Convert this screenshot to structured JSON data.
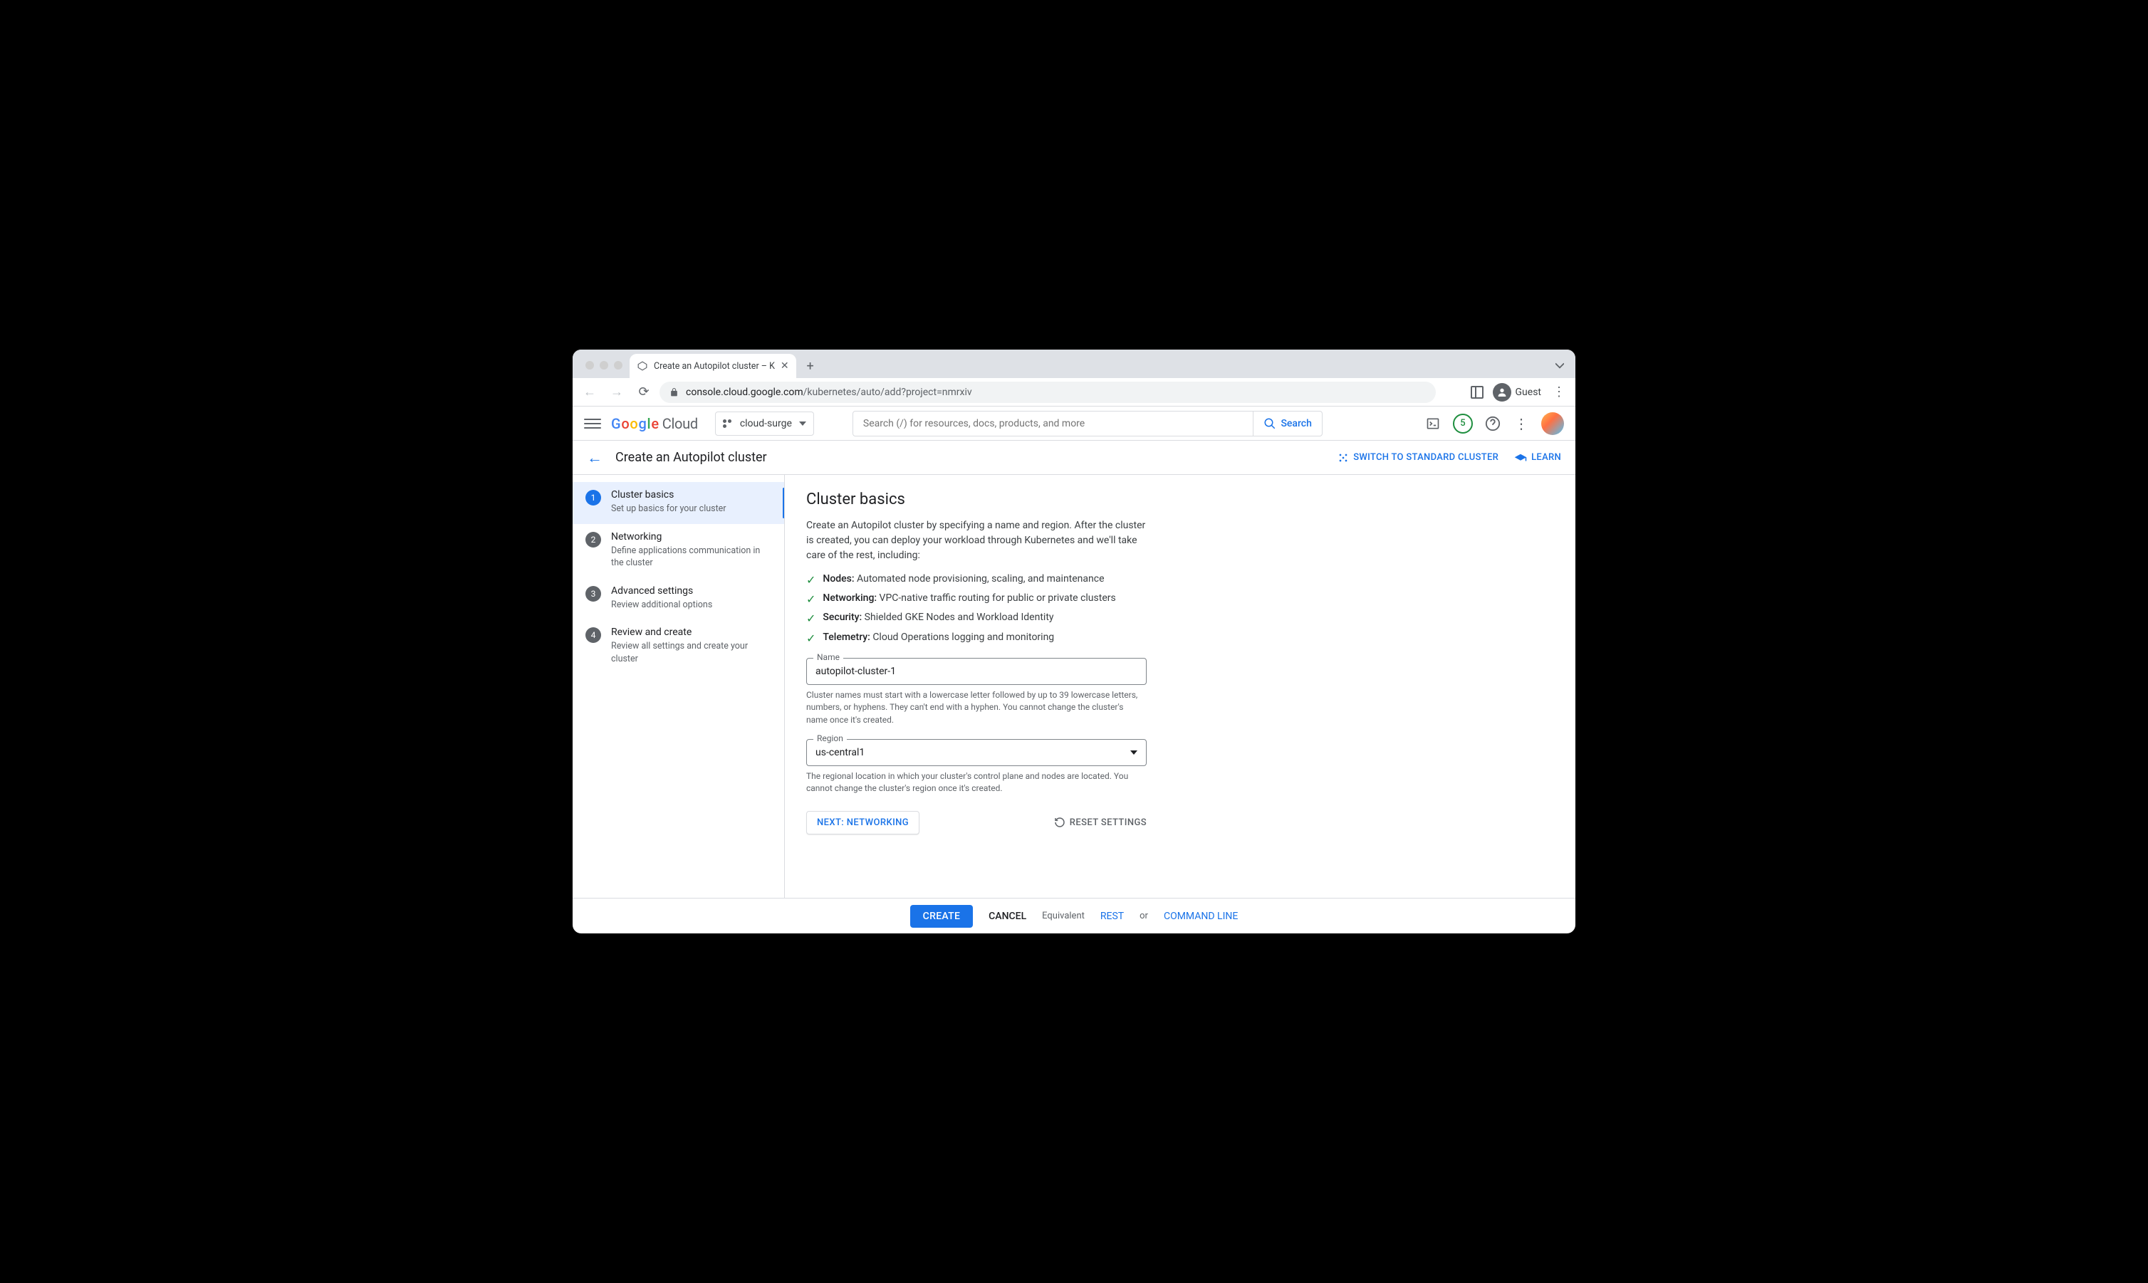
{
  "browser": {
    "tab_title": "Create an Autopilot cluster – K",
    "url_host": "console.cloud.google.com",
    "url_path": "/kubernetes/auto/add?project=nmrxiv",
    "guest_label": "Guest"
  },
  "gcp_header": {
    "logo_cloud": "Cloud",
    "project": "cloud-surge",
    "search_placeholder": "Search (/) for resources, docs, products, and more",
    "search_btn": "Search",
    "badge": "5"
  },
  "sub_header": {
    "title": "Create an Autopilot cluster",
    "switch": "SWITCH TO STANDARD CLUSTER",
    "learn": "LEARN"
  },
  "steps": [
    {
      "title": "Cluster basics",
      "desc": "Set up basics for your cluster"
    },
    {
      "title": "Networking",
      "desc": "Define applications communication in the cluster"
    },
    {
      "title": "Advanced settings",
      "desc": "Review additional options"
    },
    {
      "title": "Review and create",
      "desc": "Review all settings and create your cluster"
    }
  ],
  "main": {
    "heading": "Cluster basics",
    "intro": "Create an Autopilot cluster by specifying a name and region. After the cluster is created, you can deploy your workload through Kubernetes and we'll take care of the rest, including:",
    "features": [
      {
        "label": "Nodes:",
        "text": " Automated node provisioning, scaling, and maintenance"
      },
      {
        "label": "Networking:",
        "text": " VPC-native traffic routing for public or private clusters"
      },
      {
        "label": "Security:",
        "text": " Shielded GKE Nodes and Workload Identity"
      },
      {
        "label": "Telemetry:",
        "text": " Cloud Operations logging and monitoring"
      }
    ],
    "name_label": "Name",
    "name_value": "autopilot-cluster-1",
    "name_helper": "Cluster names must start with a lowercase letter followed by up to 39 lowercase letters, numbers, or hyphens. They can't end with a hyphen. You cannot change the cluster's name once it's created.",
    "region_label": "Region",
    "region_value": "us-central1",
    "region_helper": "The regional location in which your cluster's control plane and nodes are located. You cannot change the cluster's region once it's created.",
    "next_btn": "NEXT: NETWORKING",
    "reset": "RESET SETTINGS"
  },
  "footer": {
    "create": "CREATE",
    "cancel": "CANCEL",
    "equivalent": "Equivalent",
    "rest": "REST",
    "or": "or",
    "cmd": "COMMAND LINE"
  }
}
